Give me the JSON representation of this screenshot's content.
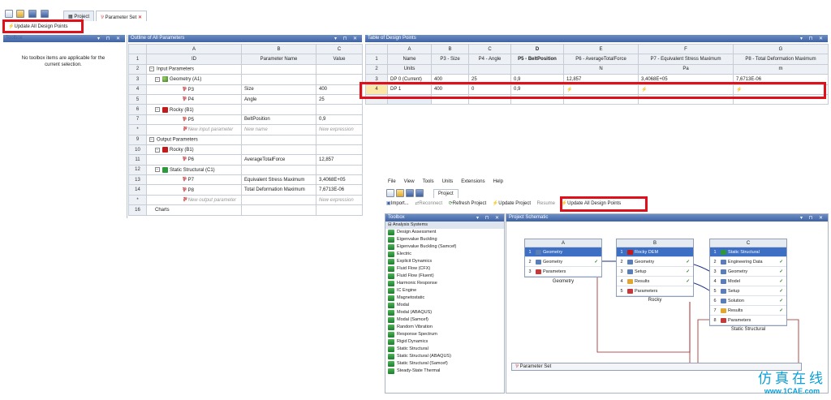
{
  "toolbar": {
    "tabs": [
      {
        "label": "Project",
        "icon": "project-icon"
      },
      {
        "label": "Parameter Set",
        "icon": "parameter-set-icon"
      }
    ],
    "update_all_label": "Update All Design Points"
  },
  "toolbox": {
    "header": "Toolbox",
    "message": "No toolbox items are applicable for the current selection."
  },
  "outline": {
    "header": "Outline of All Parameters",
    "columns": [
      "A",
      "B",
      "C"
    ],
    "col_titles": [
      "ID",
      "Parameter Name",
      "Value"
    ],
    "rows": [
      {
        "n": "2",
        "id": "Input Parameters",
        "name": "",
        "value": ""
      },
      {
        "n": "3",
        "id": "Geometry (A1)",
        "name": "",
        "value": ""
      },
      {
        "n": "4",
        "id": "P3",
        "name": "Size",
        "value": "400"
      },
      {
        "n": "5",
        "id": "P4",
        "name": "Angle",
        "value": "25"
      },
      {
        "n": "6",
        "id": "Rocky (B1)",
        "name": "",
        "value": ""
      },
      {
        "n": "7",
        "id": "P5",
        "name": "BeltPosition",
        "value": "0,9"
      },
      {
        "n": "*",
        "id": "New input parameter",
        "name": "New name",
        "value": "New expression"
      },
      {
        "n": "9",
        "id": "Output Parameters",
        "name": "",
        "value": ""
      },
      {
        "n": "10",
        "id": "Rocky (B1)",
        "name": "",
        "value": ""
      },
      {
        "n": "11",
        "id": "P6",
        "name": "AverageTotalForce",
        "value": "12,857"
      },
      {
        "n": "12",
        "id": "Static Structural (C1)",
        "name": "",
        "value": ""
      },
      {
        "n": "13",
        "id": "P7",
        "name": "Equivalent Stress Maximum",
        "value": "3,4068E+05"
      },
      {
        "n": "14",
        "id": "P8",
        "name": "Total Deformation Maximum",
        "value": "7,6713E-06"
      },
      {
        "n": "*",
        "id": "New output parameter",
        "name": "",
        "value": "New expression"
      },
      {
        "n": "16",
        "id": "Charts",
        "name": "",
        "value": ""
      }
    ]
  },
  "design_points": {
    "header": "Table of Design Points",
    "columns": [
      "A",
      "B",
      "C",
      "D",
      "E",
      "F",
      "G"
    ],
    "headers": [
      "Name",
      "P3 - Size",
      "P4 - Angle",
      "P5 - BeltPosition",
      "P6 - AverageTotalForce",
      "P7 - Equivalent Stress Maximum",
      "P8 - Total Deformation Maximum"
    ],
    "units": [
      "Units",
      "",
      "",
      "",
      "N",
      "Pa",
      "m"
    ],
    "row3": [
      "DP 0 (Current)",
      "400",
      "25",
      "0,9",
      "12,857",
      "3,4068E+05",
      "7,6713E-06"
    ],
    "row4": [
      "DP 1",
      "400",
      "0",
      "0,9",
      "",
      "",
      ""
    ]
  },
  "project": {
    "menu": [
      "File",
      "View",
      "Tools",
      "Units",
      "Extensions",
      "Help"
    ],
    "tab": "Project",
    "buttons": [
      "Import...",
      "Reconnect",
      "Refresh Project",
      "Update Project",
      "Resume",
      "Update All Design Points"
    ],
    "toolbox_header": "Toolbox",
    "toolbox_group": "Analysis Systems",
    "toolbox_items": [
      "Design Assessment",
      "Eigenvalue Buckling",
      "Eigenvalue Buckling (Samcef)",
      "Electric",
      "Explicit Dynamics",
      "Fluid Flow (CFX)",
      "Fluid Flow (Fluent)",
      "Harmonic Response",
      "IC Engine",
      "Magnetostatic",
      "Modal",
      "Modal (ABAQUS)",
      "Modal (Samcef)",
      "Random Vibration",
      "Response Spectrum",
      "Rigid Dynamics",
      "Static Structural",
      "Static Structural (ABAQUS)",
      "Static Structural (Samcef)",
      "Steady-State Thermal"
    ],
    "schematic_header": "Project Schematic",
    "blocks": [
      {
        "letter": "A",
        "rows": [
          "Geometry",
          "Geometry",
          "Parameters"
        ],
        "caption": "Geometry"
      },
      {
        "letter": "B",
        "rows": [
          "Rocky DEM",
          "Geometry",
          "Setup",
          "Results",
          "Parameters"
        ],
        "caption": "Rocky"
      },
      {
        "letter": "C",
        "rows": [
          "Static Structural",
          "Engineering Data",
          "Geometry",
          "Model",
          "Setup",
          "Solution",
          "Results",
          "Parameters"
        ],
        "caption": "Static Structural"
      }
    ],
    "parameter_set_label": "Parameter Set"
  },
  "watermark": {
    "cn": "仿真在线",
    "url": "www.1CAE.com"
  }
}
